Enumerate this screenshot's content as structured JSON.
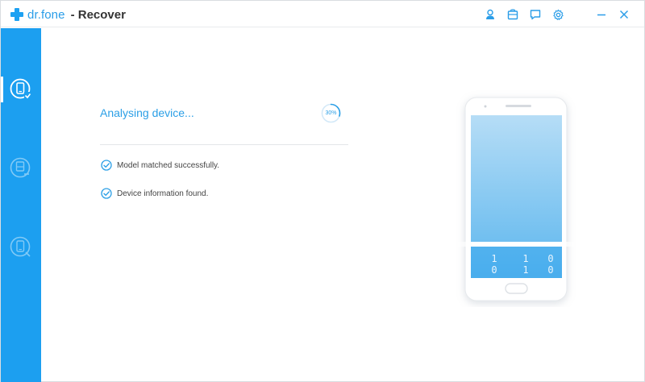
{
  "app": {
    "brand": "dr.fone",
    "title": "- Recover"
  },
  "titlebar_icons": [
    "user-icon",
    "cart-icon",
    "feedback-icon",
    "settings-icon"
  ],
  "window_controls": [
    "minimize-icon",
    "close-icon"
  ],
  "sidebar": {
    "items": [
      {
        "name": "recover-from-device",
        "active": true
      },
      {
        "name": "recover-from-itunes",
        "active": false
      },
      {
        "name": "recover-from-icloud",
        "active": false
      }
    ]
  },
  "main": {
    "status": "Analysing device...",
    "progress_label": "30%",
    "progress_value": 0.3,
    "steps": [
      {
        "label": "Model matched successfully.",
        "done": true
      },
      {
        "label": "Device information found.",
        "done": true
      }
    ]
  },
  "phone": {
    "binary_rows": [
      [
        "1",
        "1",
        "0"
      ],
      [
        "0",
        "1",
        "0"
      ]
    ]
  },
  "colors": {
    "accent": "#1c9ff0",
    "text_accent": "#2b9fe6"
  }
}
